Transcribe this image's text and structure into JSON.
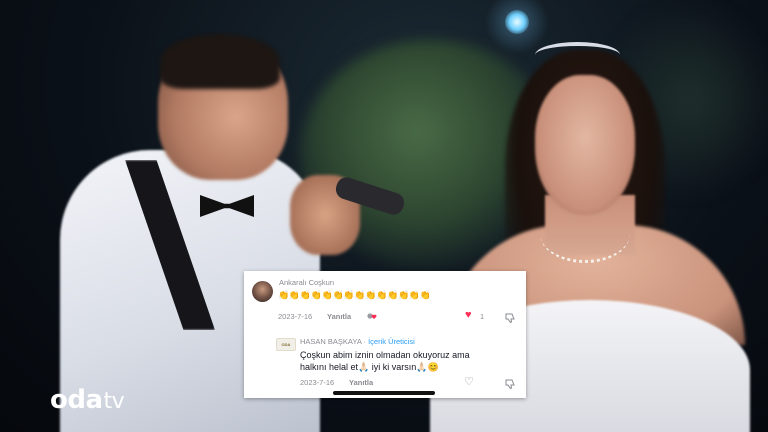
{
  "brand": {
    "logo_main": "oda",
    "logo_suffix": "tv"
  },
  "comments": [
    {
      "user": "Ankaralı Coşkun",
      "text": "👏👏👏👏👏👏👏👏👏👏👏👏👏👏",
      "date": "2023-7-16",
      "reply_label": "Yanıtla",
      "like_count": "1",
      "liked": true,
      "icon": "creator-liked-icon"
    },
    {
      "user": "HASAN BAŞKAYA",
      "separator": " · ",
      "badge": "İçerik Üreticisi",
      "text_line1": "Çoşkun abim iznin olmadan okuyoruz ama",
      "text_line2": "halkını helal et🙏🏻 iyi ki varsın🙏🏻😊",
      "date": "2023-7-16",
      "reply_label": "Yanıtla",
      "liked": false
    }
  ],
  "colors": {
    "like": "#fe2c55",
    "creator_badge": "#2a9df4",
    "text": "#161823",
    "muted": "#8a8b91"
  }
}
